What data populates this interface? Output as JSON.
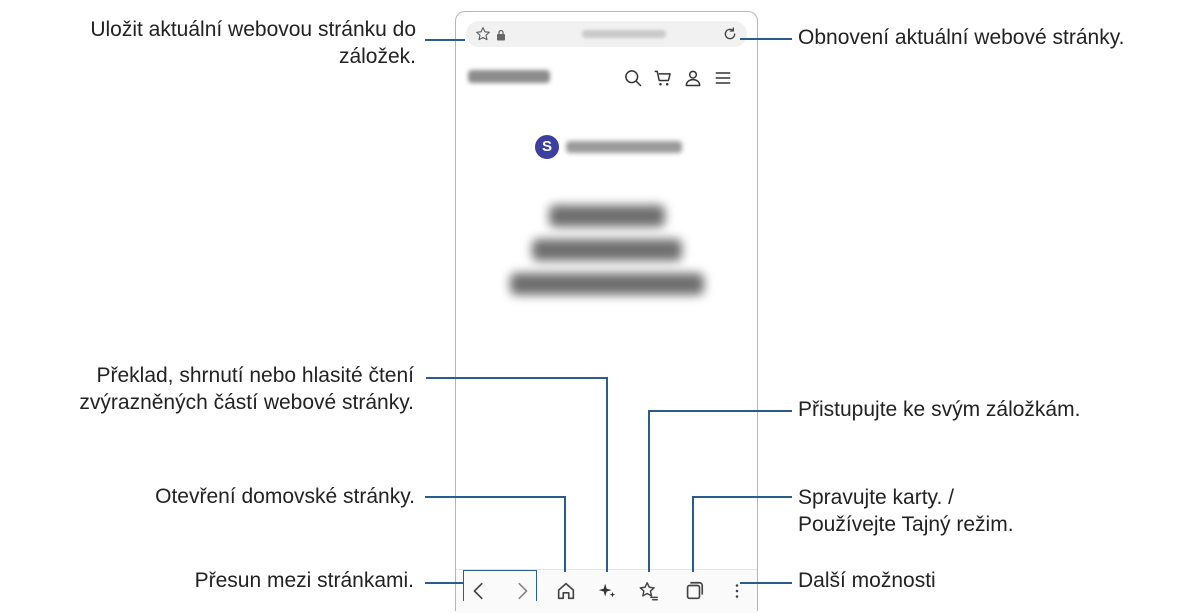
{
  "callouts": {
    "bookmark": "Uložit aktuální webovou stránku do\nzáložek.",
    "reload": "Obnovení aktuální webové stránky.",
    "translate": "Překlad, shrnutí nebo hlasité čtení\nzvýrazněných částí webové stránky.",
    "bookmarks_access": "Přistupujte ke svým záložkám.",
    "home": "Otevření domovské stránky.",
    "tabs": "Spravujte karty. /\nPoužívejte Tajný režim.",
    "navigation": "Přesun mezi stránkami.",
    "more": "Další možnosti"
  },
  "browser": {
    "brand_letter": "S"
  },
  "icons": {
    "header": [
      "search-icon",
      "cart-icon",
      "account-icon",
      "menu-icon"
    ],
    "navbar": [
      "back-icon",
      "forward-icon",
      "home-icon",
      "ai-sparkle-icon",
      "bookmarks-icon",
      "tabs-icon",
      "more-icon"
    ]
  },
  "colors": {
    "callout_line": "#2b5c8e",
    "brand": "#3b3fa0"
  }
}
